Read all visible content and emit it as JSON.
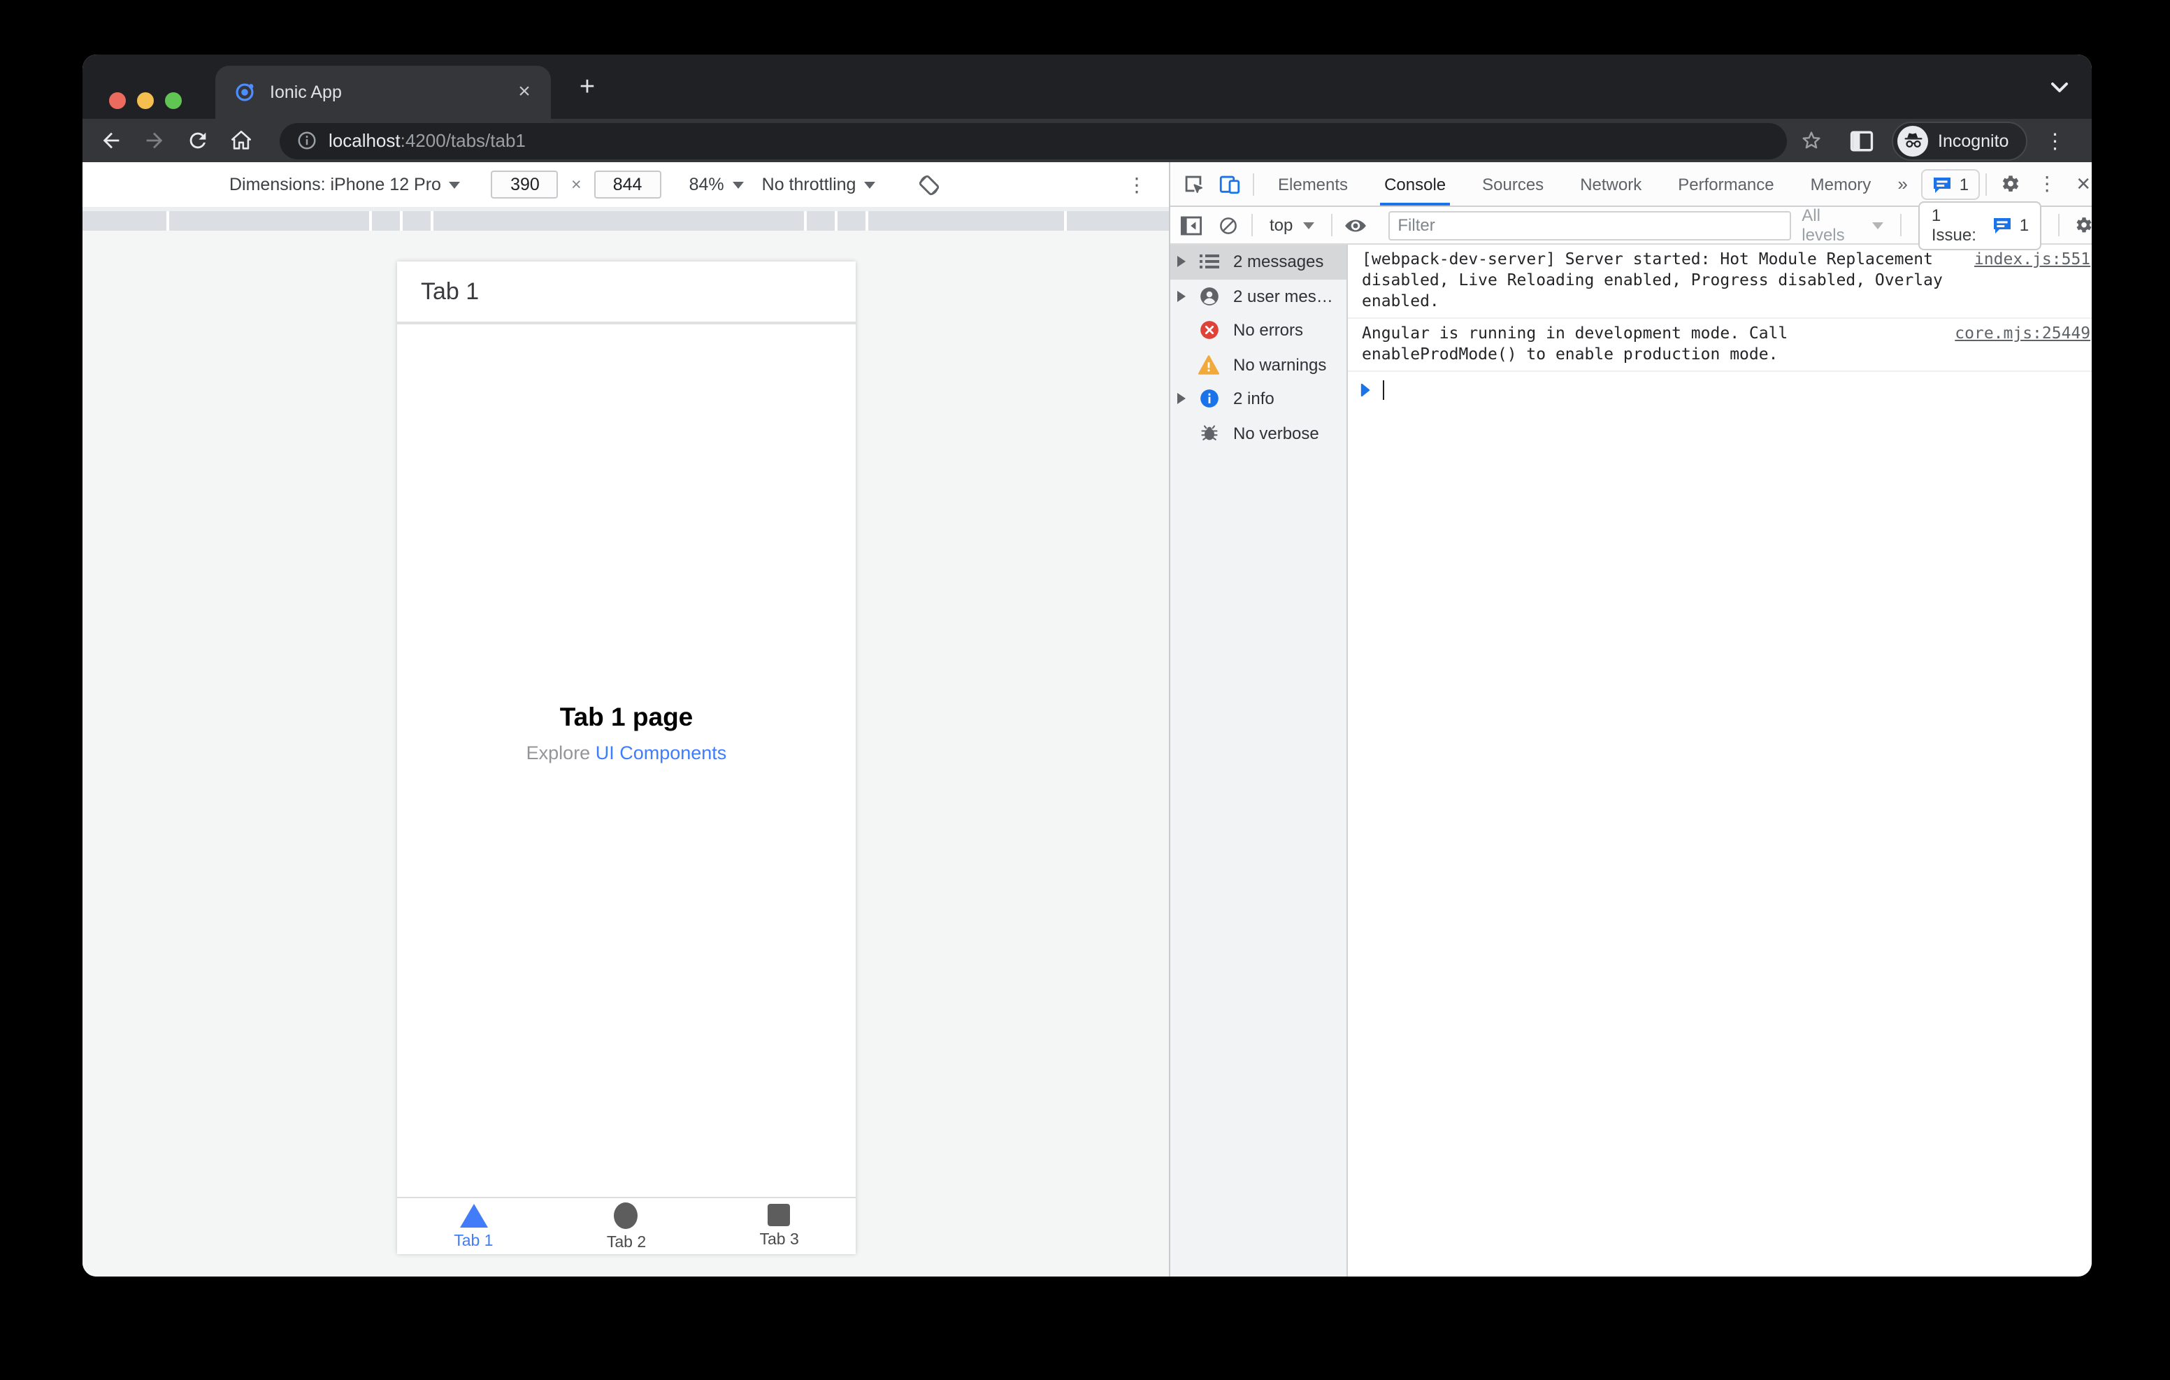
{
  "chrome": {
    "tab_title": "Ionic App",
    "new_tab_glyph": "+",
    "close_tab_glyph": "×",
    "kebab_glyph": "⋮",
    "url": {
      "host": "localhost",
      "path": ":4200/tabs/tab1"
    },
    "incognito_label": "Incognito"
  },
  "device_toolbar": {
    "dimensions_label": "Dimensions: iPhone 12 Pro",
    "width_value": "390",
    "times_glyph": "×",
    "height_value": "844",
    "zoom_value": "84%",
    "throttling_value": "No throttling",
    "kebab_glyph": "⋮"
  },
  "app": {
    "header_title": "Tab 1",
    "page_title": "Tab 1 page",
    "subtitle_prefix": "Explore ",
    "subtitle_link": "UI Components",
    "tabs": [
      {
        "label": "Tab 1"
      },
      {
        "label": "Tab 2"
      },
      {
        "label": "Tab 3"
      }
    ]
  },
  "devtools": {
    "panel_tabs": [
      "Elements",
      "Console",
      "Sources",
      "Network",
      "Performance",
      "Memory"
    ],
    "active_panel_tab": "Console",
    "more_tabs_glyph": "»",
    "issues_badge_count": "1",
    "kebab_glyph": "⋮",
    "close_glyph": "×",
    "context_selector": "top",
    "filter_placeholder": "Filter",
    "levels_label": "All levels",
    "issues_button_label": "1 Issue:",
    "issues_button_count": "1",
    "sidebar_items": [
      {
        "label": "2 messages"
      },
      {
        "label": "2 user mes…"
      },
      {
        "label": "No errors"
      },
      {
        "label": "No warnings"
      },
      {
        "label": "2 info"
      },
      {
        "label": "No verbose"
      }
    ],
    "console_messages": [
      {
        "text": "[webpack-dev-server] Server started: Hot Module Replacement disabled, Live Reloading enabled, Progress disabled, Overlay enabled.",
        "source": "index.js:551"
      },
      {
        "text": "Angular is running in development mode. Call enableProdMode() to enable production mode.",
        "source": "core.mjs:25449"
      }
    ]
  },
  "colors": {
    "devtools_accent": "#1a73e8",
    "ionic_blue": "#3d7dff",
    "error_red": "#df4237",
    "warning_yellow": "#f2a93c",
    "frame_dark": "#202124",
    "toolbar_dark": "#35363a"
  }
}
